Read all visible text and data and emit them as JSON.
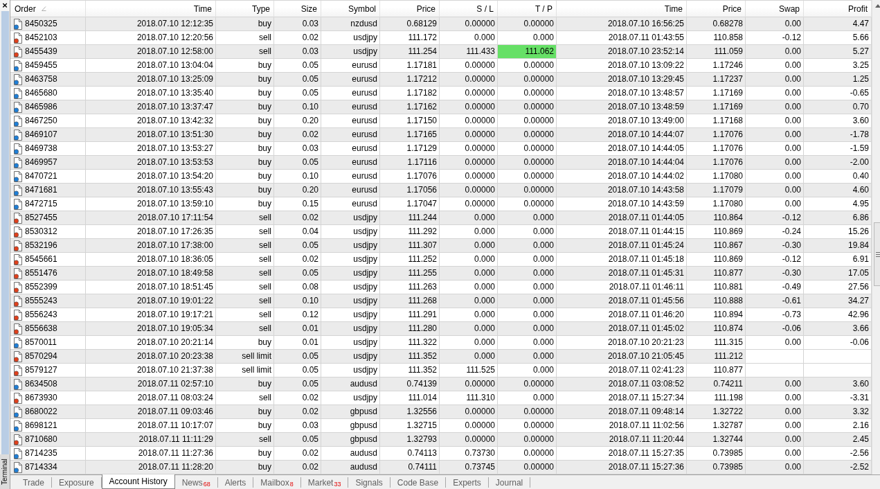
{
  "side_panel": {
    "close": "×",
    "title": "Terminal"
  },
  "table": {
    "columns": [
      {
        "label": "Order",
        "sorted": true
      },
      {
        "label": "Time",
        "sorted": false
      },
      {
        "label": "Type",
        "sorted": false
      },
      {
        "label": "Size",
        "sorted": false
      },
      {
        "label": "Symbol",
        "sorted": false
      },
      {
        "label": "Price",
        "sorted": false
      },
      {
        "label": "S / L",
        "sorted": false
      },
      {
        "label": "T / P",
        "sorted": false
      },
      {
        "label": "Time",
        "sorted": false
      },
      {
        "label": "Price",
        "sorted": false
      },
      {
        "label": "Swap",
        "sorted": false
      },
      {
        "label": "Profit",
        "sorted": false
      }
    ],
    "rows": [
      {
        "kind": "buy",
        "tp_hit": false,
        "cells": [
          "8450325",
          "2018.07.10 12:12:35",
          "buy",
          "0.03",
          "nzdusd",
          "0.68129",
          "0.00000",
          "0.00000",
          "2018.07.10 16:56:25",
          "0.68278",
          "0.00",
          "4.47"
        ]
      },
      {
        "kind": "sell",
        "tp_hit": false,
        "cells": [
          "8452103",
          "2018.07.10 12:20:56",
          "sell",
          "0.02",
          "usdjpy",
          "111.172",
          "0.000",
          "0.000",
          "2018.07.11 01:43:55",
          "110.858",
          "-0.12",
          "5.66"
        ]
      },
      {
        "kind": "sell",
        "tp_hit": true,
        "cells": [
          "8455439",
          "2018.07.10 12:58:00",
          "sell",
          "0.03",
          "usdjpy",
          "111.254",
          "111.433",
          "111.062",
          "2018.07.10 23:52:14",
          "111.059",
          "0.00",
          "5.27"
        ]
      },
      {
        "kind": "buy",
        "tp_hit": false,
        "cells": [
          "8459455",
          "2018.07.10 13:04:04",
          "buy",
          "0.05",
          "eurusd",
          "1.17181",
          "0.00000",
          "0.00000",
          "2018.07.10 13:09:22",
          "1.17246",
          "0.00",
          "3.25"
        ]
      },
      {
        "kind": "buy",
        "tp_hit": false,
        "cells": [
          "8463758",
          "2018.07.10 13:25:09",
          "buy",
          "0.05",
          "eurusd",
          "1.17212",
          "0.00000",
          "0.00000",
          "2018.07.10 13:29:45",
          "1.17237",
          "0.00",
          "1.25"
        ]
      },
      {
        "kind": "buy",
        "tp_hit": false,
        "cells": [
          "8465680",
          "2018.07.10 13:35:40",
          "buy",
          "0.05",
          "eurusd",
          "1.17182",
          "0.00000",
          "0.00000",
          "2018.07.10 13:48:57",
          "1.17169",
          "0.00",
          "-0.65"
        ]
      },
      {
        "kind": "buy",
        "tp_hit": false,
        "cells": [
          "8465986",
          "2018.07.10 13:37:47",
          "buy",
          "0.10",
          "eurusd",
          "1.17162",
          "0.00000",
          "0.00000",
          "2018.07.10 13:48:59",
          "1.17169",
          "0.00",
          "0.70"
        ]
      },
      {
        "kind": "buy",
        "tp_hit": false,
        "cells": [
          "8467250",
          "2018.07.10 13:42:32",
          "buy",
          "0.20",
          "eurusd",
          "1.17150",
          "0.00000",
          "0.00000",
          "2018.07.10 13:49:00",
          "1.17168",
          "0.00",
          "3.60"
        ]
      },
      {
        "kind": "buy",
        "tp_hit": false,
        "cells": [
          "8469107",
          "2018.07.10 13:51:30",
          "buy",
          "0.02",
          "eurusd",
          "1.17165",
          "0.00000",
          "0.00000",
          "2018.07.10 14:44:07",
          "1.17076",
          "0.00",
          "-1.78"
        ]
      },
      {
        "kind": "buy",
        "tp_hit": false,
        "cells": [
          "8469738",
          "2018.07.10 13:53:27",
          "buy",
          "0.03",
          "eurusd",
          "1.17129",
          "0.00000",
          "0.00000",
          "2018.07.10 14:44:05",
          "1.17076",
          "0.00",
          "-1.59"
        ]
      },
      {
        "kind": "buy",
        "tp_hit": false,
        "cells": [
          "8469957",
          "2018.07.10 13:53:53",
          "buy",
          "0.05",
          "eurusd",
          "1.17116",
          "0.00000",
          "0.00000",
          "2018.07.10 14:44:04",
          "1.17076",
          "0.00",
          "-2.00"
        ]
      },
      {
        "kind": "buy",
        "tp_hit": false,
        "cells": [
          "8470721",
          "2018.07.10 13:54:20",
          "buy",
          "0.10",
          "eurusd",
          "1.17076",
          "0.00000",
          "0.00000",
          "2018.07.10 14:44:02",
          "1.17080",
          "0.00",
          "0.40"
        ]
      },
      {
        "kind": "buy",
        "tp_hit": false,
        "cells": [
          "8471681",
          "2018.07.10 13:55:43",
          "buy",
          "0.20",
          "eurusd",
          "1.17056",
          "0.00000",
          "0.00000",
          "2018.07.10 14:43:58",
          "1.17079",
          "0.00",
          "4.60"
        ]
      },
      {
        "kind": "buy",
        "tp_hit": false,
        "cells": [
          "8472715",
          "2018.07.10 13:59:10",
          "buy",
          "0.15",
          "eurusd",
          "1.17047",
          "0.00000",
          "0.00000",
          "2018.07.10 14:43:59",
          "1.17080",
          "0.00",
          "4.95"
        ]
      },
      {
        "kind": "sell",
        "tp_hit": false,
        "cells": [
          "8527455",
          "2018.07.10 17:11:54",
          "sell",
          "0.02",
          "usdjpy",
          "111.244",
          "0.000",
          "0.000",
          "2018.07.11 01:44:05",
          "110.864",
          "-0.12",
          "6.86"
        ]
      },
      {
        "kind": "sell",
        "tp_hit": false,
        "cells": [
          "8530312",
          "2018.07.10 17:26:35",
          "sell",
          "0.04",
          "usdjpy",
          "111.292",
          "0.000",
          "0.000",
          "2018.07.11 01:44:15",
          "110.869",
          "-0.24",
          "15.26"
        ]
      },
      {
        "kind": "sell",
        "tp_hit": false,
        "cells": [
          "8532196",
          "2018.07.10 17:38:00",
          "sell",
          "0.05",
          "usdjpy",
          "111.307",
          "0.000",
          "0.000",
          "2018.07.11 01:45:24",
          "110.867",
          "-0.30",
          "19.84"
        ]
      },
      {
        "kind": "sell",
        "tp_hit": false,
        "cells": [
          "8545661",
          "2018.07.10 18:36:05",
          "sell",
          "0.02",
          "usdjpy",
          "111.252",
          "0.000",
          "0.000",
          "2018.07.11 01:45:18",
          "110.869",
          "-0.12",
          "6.91"
        ]
      },
      {
        "kind": "sell",
        "tp_hit": false,
        "cells": [
          "8551476",
          "2018.07.10 18:49:58",
          "sell",
          "0.05",
          "usdjpy",
          "111.255",
          "0.000",
          "0.000",
          "2018.07.11 01:45:31",
          "110.877",
          "-0.30",
          "17.05"
        ]
      },
      {
        "kind": "sell",
        "tp_hit": false,
        "cells": [
          "8552399",
          "2018.07.10 18:51:45",
          "sell",
          "0.08",
          "usdjpy",
          "111.263",
          "0.000",
          "0.000",
          "2018.07.11 01:46:11",
          "110.881",
          "-0.49",
          "27.56"
        ]
      },
      {
        "kind": "sell",
        "tp_hit": false,
        "cells": [
          "8555243",
          "2018.07.10 19:01:22",
          "sell",
          "0.10",
          "usdjpy",
          "111.268",
          "0.000",
          "0.000",
          "2018.07.11 01:45:56",
          "110.888",
          "-0.61",
          "34.27"
        ]
      },
      {
        "kind": "sell",
        "tp_hit": false,
        "cells": [
          "8556243",
          "2018.07.10 19:17:21",
          "sell",
          "0.12",
          "usdjpy",
          "111.291",
          "0.000",
          "0.000",
          "2018.07.11 01:46:20",
          "110.894",
          "-0.73",
          "42.96"
        ]
      },
      {
        "kind": "sell",
        "tp_hit": false,
        "cells": [
          "8556638",
          "2018.07.10 19:05:34",
          "sell",
          "0.01",
          "usdjpy",
          "111.280",
          "0.000",
          "0.000",
          "2018.07.11 01:45:02",
          "110.874",
          "-0.06",
          "3.66"
        ]
      },
      {
        "kind": "buy",
        "tp_hit": false,
        "cells": [
          "8570011",
          "2018.07.10 20:21:14",
          "buy",
          "0.01",
          "usdjpy",
          "111.322",
          "0.000",
          "0.000",
          "2018.07.10 20:21:23",
          "111.315",
          "0.00",
          "-0.06"
        ]
      },
      {
        "kind": "sell",
        "tp_hit": false,
        "cells": [
          "8570294",
          "2018.07.10 20:23:38",
          "sell limit",
          "0.05",
          "usdjpy",
          "111.352",
          "0.000",
          "0.000",
          "2018.07.10 21:05:45",
          "111.212"
        ]
      },
      {
        "kind": "sell",
        "tp_hit": false,
        "cells": [
          "8579127",
          "2018.07.10 21:37:38",
          "sell limit",
          "0.05",
          "usdjpy",
          "111.352",
          "111.525",
          "0.000",
          "2018.07.11 02:41:23",
          "110.877"
        ]
      },
      {
        "kind": "buy",
        "tp_hit": false,
        "cells": [
          "8634508",
          "2018.07.11 02:57:10",
          "buy",
          "0.05",
          "audusd",
          "0.74139",
          "0.00000",
          "0.00000",
          "2018.07.11 03:08:52",
          "0.74211",
          "0.00",
          "3.60"
        ]
      },
      {
        "kind": "sell",
        "tp_hit": false,
        "cells": [
          "8673930",
          "2018.07.11 08:03:24",
          "sell",
          "0.02",
          "usdjpy",
          "111.014",
          "111.310",
          "0.000",
          "2018.07.11 15:27:34",
          "111.198",
          "0.00",
          "-3.31"
        ]
      },
      {
        "kind": "buy",
        "tp_hit": false,
        "cells": [
          "8680022",
          "2018.07.11 09:03:46",
          "buy",
          "0.02",
          "gbpusd",
          "1.32556",
          "0.00000",
          "0.00000",
          "2018.07.11 09:48:14",
          "1.32722",
          "0.00",
          "3.32"
        ]
      },
      {
        "kind": "buy",
        "tp_hit": false,
        "cells": [
          "8698121",
          "2018.07.11 10:17:07",
          "buy",
          "0.03",
          "gbpusd",
          "1.32715",
          "0.00000",
          "0.00000",
          "2018.07.11 11:02:56",
          "1.32787",
          "0.00",
          "2.16"
        ]
      },
      {
        "kind": "sell",
        "tp_hit": false,
        "cells": [
          "8710680",
          "2018.07.11 11:11:29",
          "sell",
          "0.05",
          "gbpusd",
          "1.32793",
          "0.00000",
          "0.00000",
          "2018.07.11 11:20:44",
          "1.32744",
          "0.00",
          "2.45"
        ]
      },
      {
        "kind": "buy",
        "tp_hit": false,
        "cells": [
          "8714235",
          "2018.07.11 11:27:36",
          "buy",
          "0.02",
          "audusd",
          "0.74113",
          "0.73730",
          "0.00000",
          "2018.07.11 15:27:35",
          "0.73985",
          "0.00",
          "-2.56"
        ]
      },
      {
        "kind": "buy",
        "tp_hit": false,
        "cells": [
          "8714334",
          "2018.07.11 11:28:20",
          "buy",
          "0.02",
          "audusd",
          "0.74111",
          "0.73745",
          "0.00000",
          "2018.07.11 15:27:36",
          "0.73985",
          "0.00",
          "-2.52"
        ]
      }
    ]
  },
  "tabs": [
    {
      "label": "Trade",
      "selected": false
    },
    {
      "label": "Exposure",
      "selected": false
    },
    {
      "label": "Account History",
      "selected": true
    },
    {
      "label": "News",
      "badge": "68",
      "selected": false
    },
    {
      "label": "Alerts",
      "selected": false
    },
    {
      "label": "Mailbox",
      "badge": "8",
      "selected": false
    },
    {
      "label": "Market",
      "badge": "33",
      "selected": false
    },
    {
      "label": "Signals",
      "selected": false
    },
    {
      "label": "Code Base",
      "selected": false
    },
    {
      "label": "Experts",
      "selected": false
    },
    {
      "label": "Journal",
      "selected": false
    }
  ]
}
